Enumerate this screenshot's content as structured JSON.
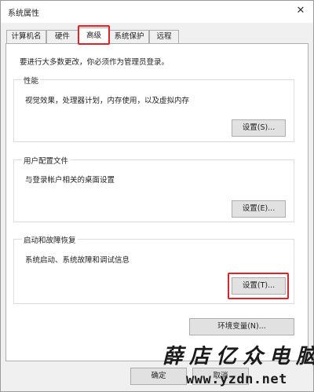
{
  "window": {
    "title": "系统属性",
    "close_glyph": "✕"
  },
  "tabs": [
    {
      "label": "计算机名",
      "active": false
    },
    {
      "label": "硬件",
      "active": false
    },
    {
      "label": "高级",
      "active": true
    },
    {
      "label": "系统保护",
      "active": false
    },
    {
      "label": "远程",
      "active": false
    }
  ],
  "advanced": {
    "admin_note": "要进行大多数更改，你必须作为管理员登录。",
    "performance": {
      "title": "性能",
      "description": "视觉效果，处理器计划，内存使用，以及虚拟内存",
      "button": "设置(S)..."
    },
    "user_profiles": {
      "title": "用户配置文件",
      "description": "与登录帐户相关的桌面设置",
      "button": "设置(E)..."
    },
    "startup_recovery": {
      "title": "启动和故障恢复",
      "description": "系统启动、系统故障和调试信息",
      "button": "设置(T)..."
    },
    "env_button": "环境变量(N)..."
  },
  "footer": {
    "ok": "确定",
    "cancel": "取消"
  },
  "watermark": {
    "text": "薛店亿众电脑",
    "url": "www.yzdn.net"
  },
  "colors": {
    "highlight": "#d9262b",
    "window_bg": "#f0f0f0",
    "button_bg": "#e1e1e1"
  }
}
